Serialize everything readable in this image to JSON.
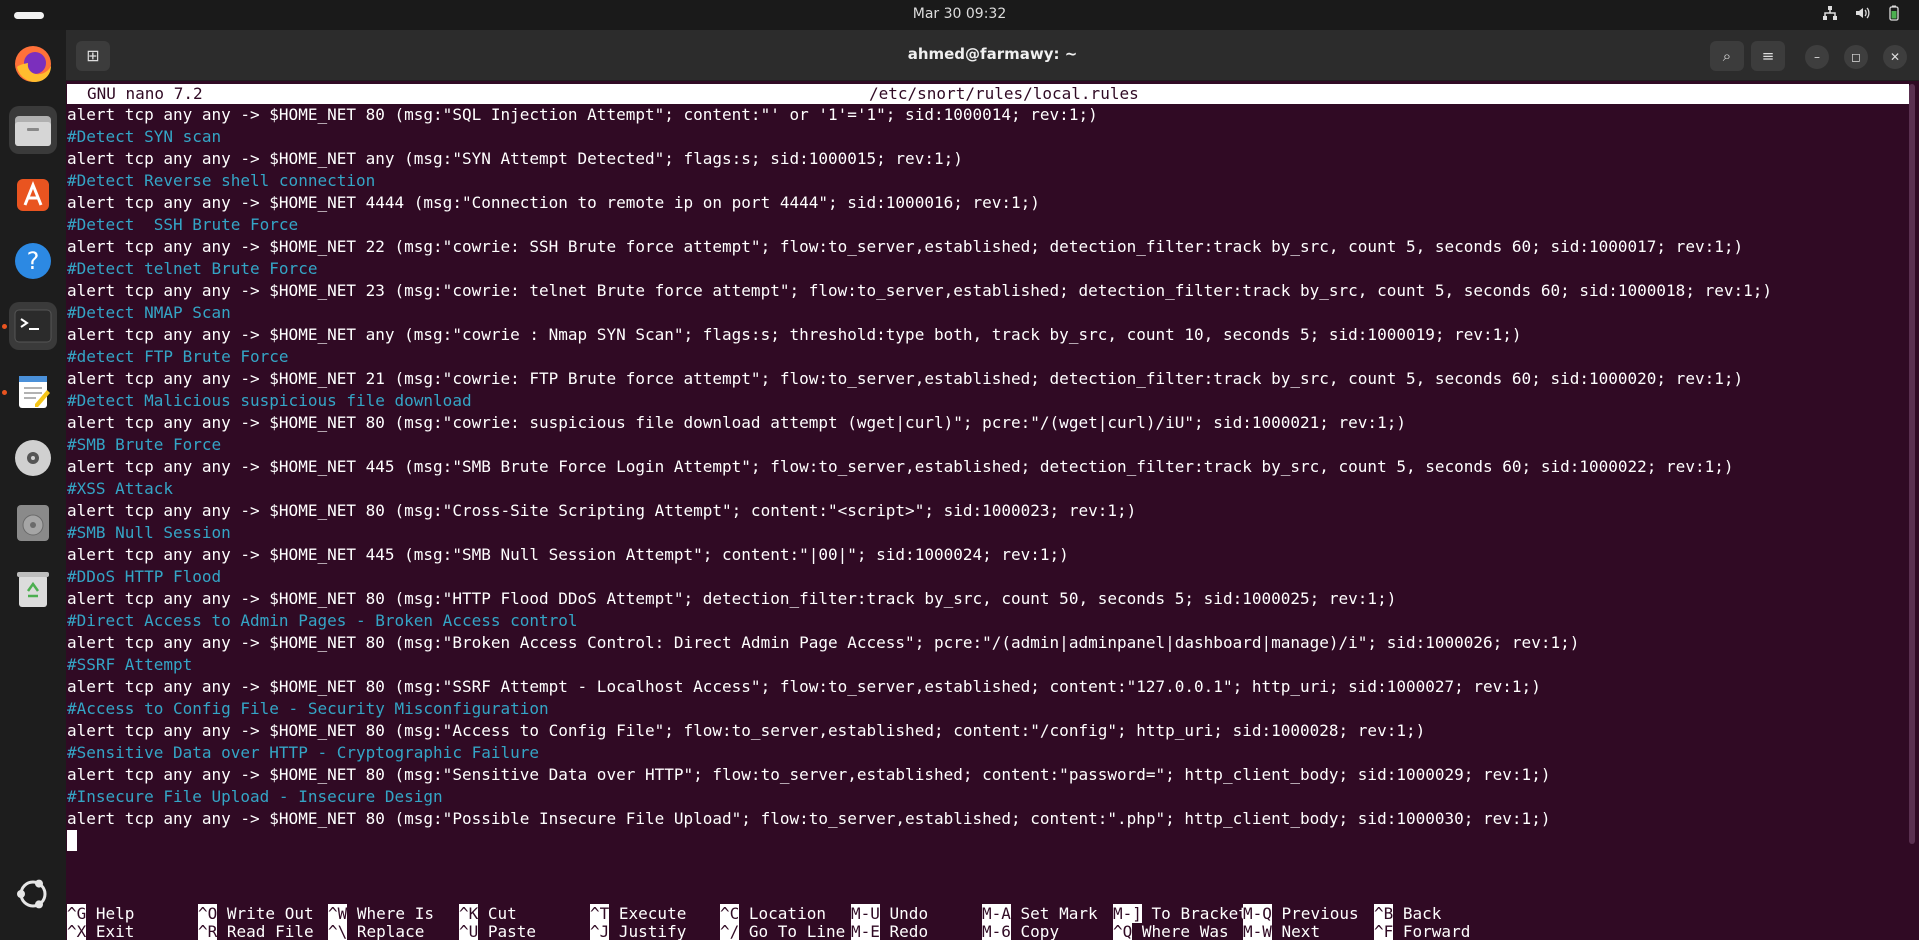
{
  "topbar": {
    "datetime": "Mar 30  09:32",
    "tray_icons": [
      "network-icon",
      "volume-icon",
      "battery-icon"
    ]
  },
  "dock": {
    "apps": [
      {
        "name": "firefox",
        "icon": "firefox-icon",
        "color": "#ff7139"
      },
      {
        "name": "files",
        "icon": "folder-icon",
        "color": "#c8c8c8"
      },
      {
        "name": "app-center",
        "icon": "app-center-icon",
        "color": "#e95420"
      },
      {
        "name": "help",
        "icon": "help-icon",
        "color": "#2c89e3"
      },
      {
        "name": "terminal",
        "icon": "terminal-icon",
        "color": "#2b2b2b"
      },
      {
        "name": "text-editor",
        "icon": "text-editor-icon",
        "color": "#f5c518"
      },
      {
        "name": "disc",
        "icon": "disc-icon",
        "color": "#d0d0d0"
      },
      {
        "name": "disc-2",
        "icon": "disc-icon",
        "color": "#8a8a8a"
      },
      {
        "name": "trash",
        "icon": "trash-icon",
        "color": "#4caf50"
      }
    ],
    "ubuntu_logo": "ubuntu-logo-icon"
  },
  "window": {
    "title": "ahmed@farmawy: ~",
    "new_tab_glyph": "⊞",
    "search_glyph": "⌕",
    "menu_glyph": "≡",
    "minimize_glyph": "–",
    "maximize_glyph": "◻",
    "close_glyph": "✕"
  },
  "nano": {
    "version": "GNU nano 7.2",
    "filename": "/etc/snort/rules/local.rules",
    "lines": [
      {
        "type": "rule",
        "text": "alert tcp any any -> $HOME_NET 80 (msg:\"SQL Injection Attempt\"; content:\"' or '1'='1\"; sid:1000014; rev:1;)"
      },
      {
        "type": "comment",
        "text": "#Detect SYN scan"
      },
      {
        "type": "rule",
        "text": "alert tcp any any -> $HOME_NET any (msg:\"SYN Attempt Detected\"; flags:s; sid:1000015; rev:1;)"
      },
      {
        "type": "comment",
        "text": "#Detect Reverse shell connection"
      },
      {
        "type": "rule",
        "text": "alert tcp any any -> $HOME_NET 4444 (msg:\"Connection to remote ip on port 4444\"; sid:1000016; rev:1;)"
      },
      {
        "type": "comment",
        "text": "#Detect  SSH Brute Force"
      },
      {
        "type": "rule",
        "text": "alert tcp any any -> $HOME_NET 22 (msg:\"cowrie: SSH Brute force attempt\"; flow:to_server,established; detection_filter:track by_src, count 5, seconds 60; sid:1000017; rev:1;)"
      },
      {
        "type": "comment",
        "text": "#Detect telnet Brute Force"
      },
      {
        "type": "rule",
        "text": "alert tcp any any -> $HOME_NET 23 (msg:\"cowrie: telnet Brute force attempt\"; flow:to_server,established; detection_filter:track by_src, count 5, seconds 60; sid:1000018; rev:1;)"
      },
      {
        "type": "comment",
        "text": "#Detect NMAP Scan"
      },
      {
        "type": "rule",
        "text": "alert tcp any any -> $HOME_NET any (msg:\"cowrie : Nmap SYN Scan\"; flags:s; threshold:type both, track by_src, count 10, seconds 5; sid:1000019; rev:1;)"
      },
      {
        "type": "comment",
        "text": "#detect FTP Brute Force"
      },
      {
        "type": "rule",
        "text": "alert tcp any any -> $HOME_NET 21 (msg:\"cowrie: FTP Brute force attempt\"; flow:to_server,established; detection_filter:track by_src, count 5, seconds 60; sid:1000020; rev:1;)"
      },
      {
        "type": "comment",
        "text": "#Detect Malicious suspicious file download"
      },
      {
        "type": "rule",
        "text": "alert tcp any any -> $HOME_NET 80 (msg:\"cowrie: suspicious file download attempt (wget|curl)\"; pcre:\"/(wget|curl)/iU\"; sid:1000021; rev:1;)"
      },
      {
        "type": "comment",
        "text": "#SMB Brute Force"
      },
      {
        "type": "rule",
        "text": "alert tcp any any -> $HOME_NET 445 (msg:\"SMB Brute Force Login Attempt\"; flow:to_server,established; detection_filter:track by_src, count 5, seconds 60; sid:1000022; rev:1;)"
      },
      {
        "type": "comment",
        "text": "#XSS Attack"
      },
      {
        "type": "rule",
        "text": "alert tcp any any -> $HOME_NET 80 (msg:\"Cross-Site Scripting Attempt\"; content:\"<script>\"; sid:1000023; rev:1;)"
      },
      {
        "type": "comment",
        "text": "#SMB Null Session"
      },
      {
        "type": "rule",
        "text": "alert tcp any any -> $HOME_NET 445 (msg:\"SMB Null Session Attempt\"; content:\"|00|\"; sid:1000024; rev:1;)"
      },
      {
        "type": "comment",
        "text": "#DDoS HTTP Flood"
      },
      {
        "type": "rule",
        "text": "alert tcp any any -> $HOME_NET 80 (msg:\"HTTP Flood DDoS Attempt\"; detection_filter:track by_src, count 50, seconds 5; sid:1000025; rev:1;)"
      },
      {
        "type": "comment",
        "text": "#Direct Access to Admin Pages - Broken Access control"
      },
      {
        "type": "rule",
        "text": "alert tcp any any -> $HOME_NET 80 (msg:\"Broken Access Control: Direct Admin Page Access\"; pcre:\"/(admin|adminpanel|dashboard|manage)/i\"; sid:1000026; rev:1;)"
      },
      {
        "type": "comment",
        "text": "#SSRF Attempt"
      },
      {
        "type": "rule",
        "text": "alert tcp any any -> $HOME_NET 80 (msg:\"SSRF Attempt - Localhost Access\"; flow:to_server,established; content:\"127.0.0.1\"; http_uri; sid:1000027; rev:1;)"
      },
      {
        "type": "comment",
        "text": "#Access to Config File - Security Misconfiguration"
      },
      {
        "type": "rule",
        "text": "alert tcp any any -> $HOME_NET 80 (msg:\"Access to Config File\"; flow:to_server,established; content:\"/config\"; http_uri; sid:1000028; rev:1;)"
      },
      {
        "type": "comment",
        "text": "#Sensitive Data over HTTP - Cryptographic Failure"
      },
      {
        "type": "rule",
        "text": "alert tcp any any -> $HOME_NET 80 (msg:\"Sensitive Data over HTTP\"; flow:to_server,established; content:\"password=\"; http_client_body; sid:1000029; rev:1;)"
      },
      {
        "type": "comment",
        "text": "#Insecure File Upload - Insecure Design"
      },
      {
        "type": "rule",
        "text": "alert tcp any any -> $HOME_NET 80 (msg:\"Possible Insecure File Upload\"; flow:to_server,established; content:\".php\"; http_client_body; sid:1000030; rev:1;)"
      }
    ],
    "shortcuts": [
      {
        "key": "^G",
        "label": "Help"
      },
      {
        "key": "^X",
        "label": "Exit"
      },
      {
        "key": "^O",
        "label": "Write Out"
      },
      {
        "key": "^R",
        "label": "Read File"
      },
      {
        "key": "^W",
        "label": "Where Is"
      },
      {
        "key": "^\\",
        "label": "Replace"
      },
      {
        "key": "^K",
        "label": "Cut"
      },
      {
        "key": "^U",
        "label": "Paste"
      },
      {
        "key": "^T",
        "label": "Execute"
      },
      {
        "key": "^J",
        "label": "Justify"
      },
      {
        "key": "^C",
        "label": "Location"
      },
      {
        "key": "^/",
        "label": "Go To Line"
      },
      {
        "key": "M-U",
        "label": "Undo"
      },
      {
        "key": "M-E",
        "label": "Redo"
      },
      {
        "key": "M-A",
        "label": "Set Mark"
      },
      {
        "key": "M-6",
        "label": "Copy"
      },
      {
        "key": "M-]",
        "label": "To Bracket"
      },
      {
        "key": "^Q",
        "label": "Where Was"
      },
      {
        "key": "M-Q",
        "label": "Previous"
      },
      {
        "key": "M-W",
        "label": "Next"
      },
      {
        "key": "^B",
        "label": "Back"
      },
      {
        "key": "^F",
        "label": "Forward"
      }
    ]
  },
  "colors": {
    "terminal_bg": "#300a24",
    "comment": "#34a5c6",
    "text": "#ffffff"
  }
}
